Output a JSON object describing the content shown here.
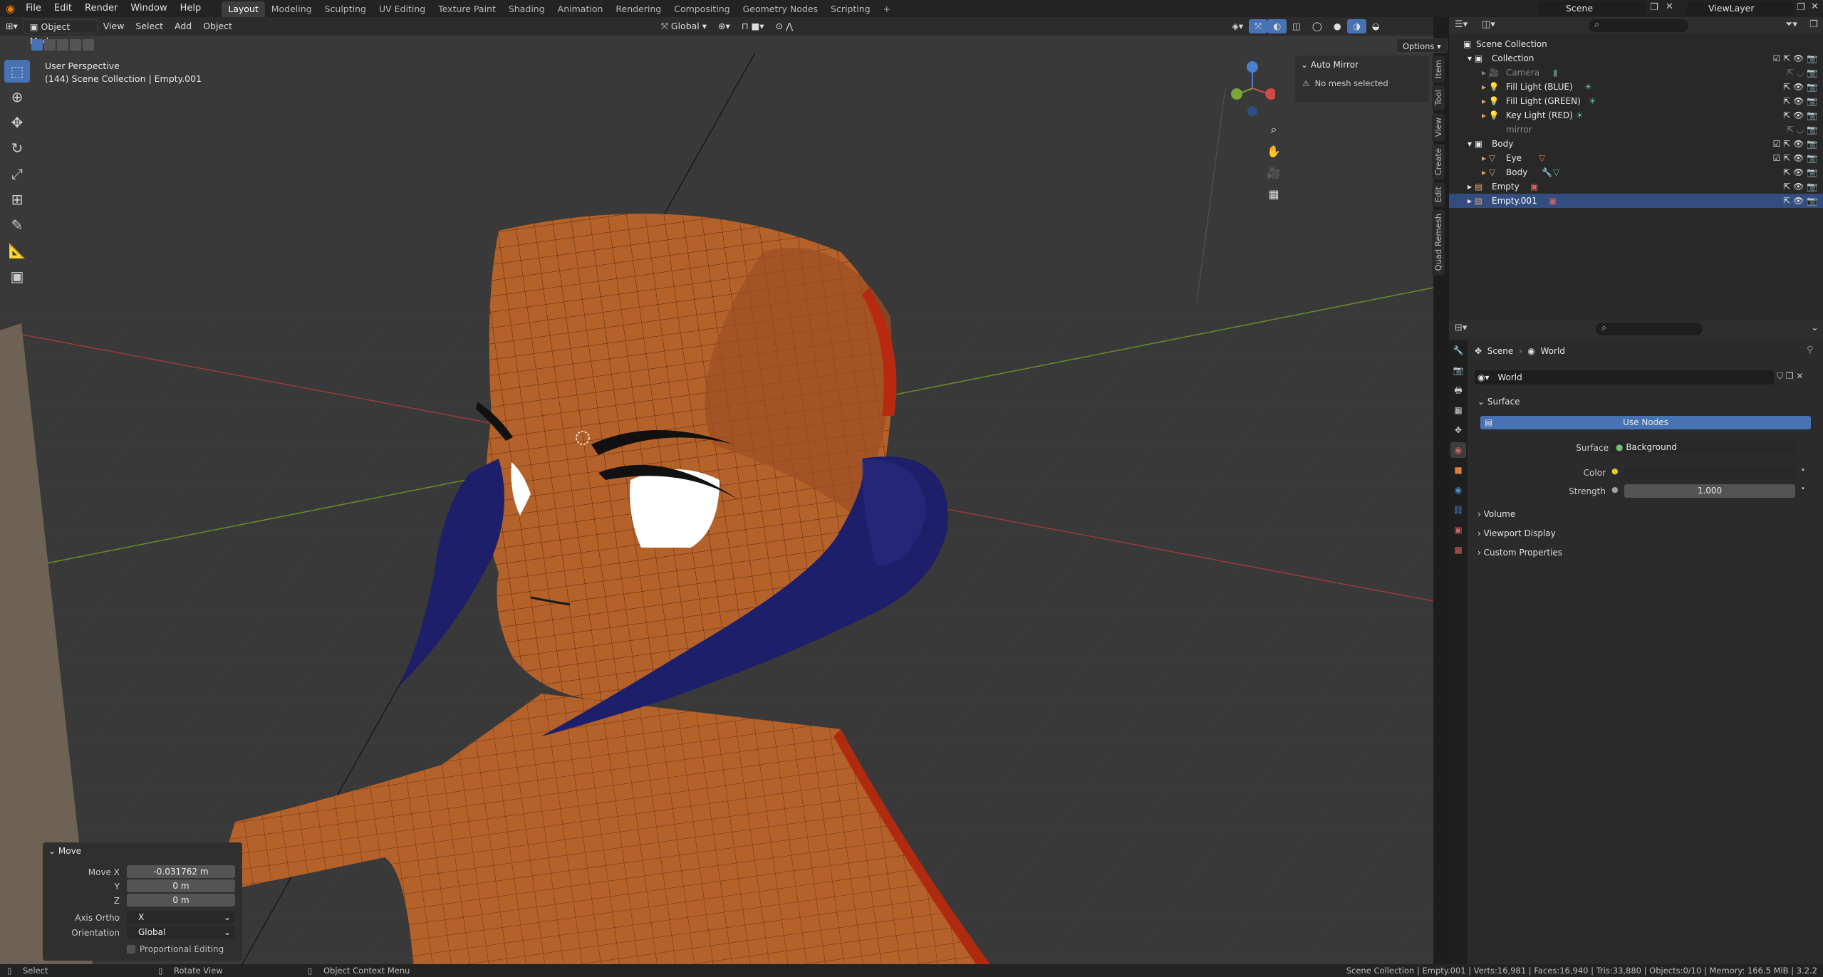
{
  "topbar": {
    "menus": [
      "File",
      "Edit",
      "Render",
      "Window",
      "Help"
    ],
    "workspaces": [
      "Layout",
      "Modeling",
      "Sculpting",
      "UV Editing",
      "Texture Paint",
      "Shading",
      "Animation",
      "Rendering",
      "Compositing",
      "Geometry Nodes",
      "Scripting"
    ],
    "add_tab": "+",
    "scene": "Scene",
    "view_layer": "ViewLayer"
  },
  "viewport": {
    "mode": "Object Mode",
    "menus": [
      "View",
      "Select",
      "Add",
      "Object"
    ],
    "orientation": "Global",
    "options": "Options",
    "perspective": "User Perspective",
    "context": "(144) Scene Collection | Empty.001",
    "npanel": {
      "title": "Auto Mirror",
      "message": "No mesh selected"
    },
    "ntabs": [
      "Item",
      "Tool",
      "View",
      "Create",
      "Edit",
      "Quad Remesh"
    ]
  },
  "move_panel": {
    "title": "Move",
    "move_x_label": "Move X",
    "move_x": "-0.031762 m",
    "y_label": "Y",
    "y": "0 m",
    "z_label": "Z",
    "z": "0 m",
    "axis_ortho_label": "Axis Ortho",
    "axis_ortho": "X",
    "orientation_label": "Orientation",
    "orientation": "Global",
    "proportional": "Proportional Editing"
  },
  "outliner": {
    "root": "Scene Collection",
    "items": [
      {
        "label": "Collection",
        "indent": 1
      },
      {
        "label": "Camera",
        "indent": 2
      },
      {
        "label": "Fill Light (BLUE)",
        "indent": 2
      },
      {
        "label": "Fill Light (GREEN)",
        "indent": 2
      },
      {
        "label": "Key Light (RED)",
        "indent": 2
      },
      {
        "label": "mirror",
        "indent": 2
      },
      {
        "label": "Body",
        "indent": 1
      },
      {
        "label": "Eye",
        "indent": 2
      },
      {
        "label": "Body",
        "indent": 2
      },
      {
        "label": "Empty",
        "indent": 1
      },
      {
        "label": "Empty.001",
        "indent": 1
      }
    ]
  },
  "properties": {
    "breadcrumb_scene": "Scene",
    "breadcrumb_world": "World",
    "world_name": "World",
    "surface_header": "Surface",
    "use_nodes": "Use Nodes",
    "surface_label": "Surface",
    "surface_value": "Background",
    "color_label": "Color",
    "strength_label": "Strength",
    "strength_value": "1.000",
    "volume": "Volume",
    "viewport_display": "Viewport Display",
    "custom_properties": "Custom Properties"
  },
  "statusbar": {
    "select": "Select",
    "rotate": "Rotate View",
    "context_menu": "Object Context Menu",
    "stats": "Scene Collection | Empty.001 | Verts:16,981 | Faces:16,940 | Tris:33,880 | Objects:0/10 | Memory: 166.5 MiB | 3.2.2"
  },
  "colors": {
    "accent": "#4772b3",
    "selected_row": "#334d80",
    "skin": "#b5612a",
    "horn": "#1d1f6b"
  }
}
